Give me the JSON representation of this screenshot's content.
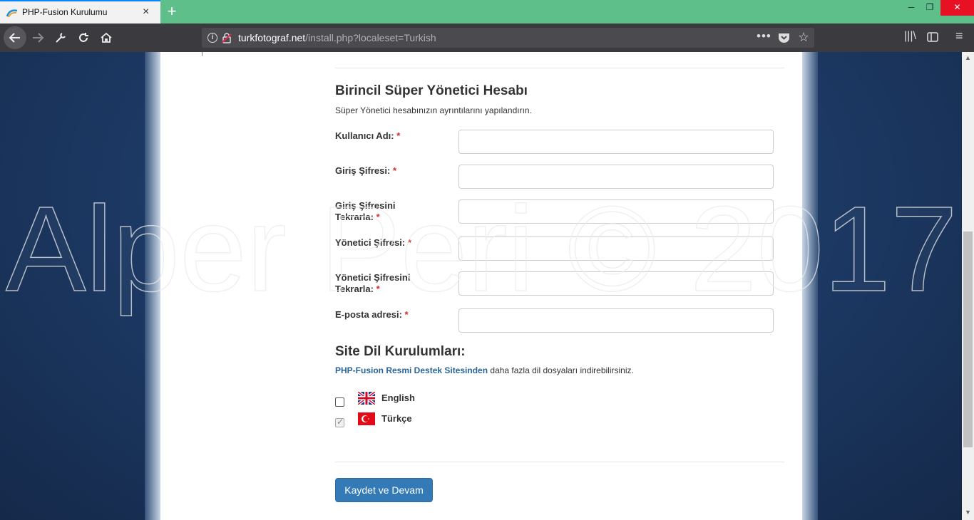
{
  "browser": {
    "tab_title": "PHP-Fusion Kurulumu",
    "tab_close": "×",
    "new_tab": "+",
    "url_domain": "turkfotograf.net",
    "url_path": "/install.php?localeset=Turkish",
    "url_more": "•••",
    "window_minimize": "─",
    "window_restore": "❐",
    "window_close": "✕"
  },
  "form": {
    "section_title": "Birincil Süper Yönetici Hesabı",
    "section_desc": "Süper Yönetici hesabınızın ayrıntılarını yapılandırın.",
    "required_mark": "*",
    "fields": [
      {
        "label": "Kullanıcı Adı:",
        "value": ""
      },
      {
        "label": "Giriş Şifresi:",
        "value": ""
      },
      {
        "label": "Giriş Şifresini Tekrarla:",
        "value": ""
      },
      {
        "label": "Yönetici Şifresi:",
        "value": ""
      },
      {
        "label": "Yönetici Şifresini Tekrarla:",
        "value": ""
      },
      {
        "label": "E-posta adresi:",
        "value": ""
      }
    ]
  },
  "language": {
    "title": "Site Dil Kurulumları:",
    "link_text": "PHP-Fusion Resmi Destek Sitesinden",
    "desc_rest": " daha fazla dil dosyaları indirebilirsiniz.",
    "options": [
      {
        "name": "English",
        "checked": false,
        "flag_icon": "uk-flag-icon"
      },
      {
        "name": "Türkçe",
        "checked": true,
        "flag_icon": "turkey-flag-icon"
      }
    ]
  },
  "submit_label": "Kaydet ve Devam",
  "watermark": "Alper Peri © 2017",
  "colors": {
    "tabbar": "#5fbf8a",
    "navbar": "#3b3b3f",
    "page_bg": "#1d3b67",
    "button": "#337ab7",
    "link": "#2a6496",
    "required": "#c9302c"
  }
}
